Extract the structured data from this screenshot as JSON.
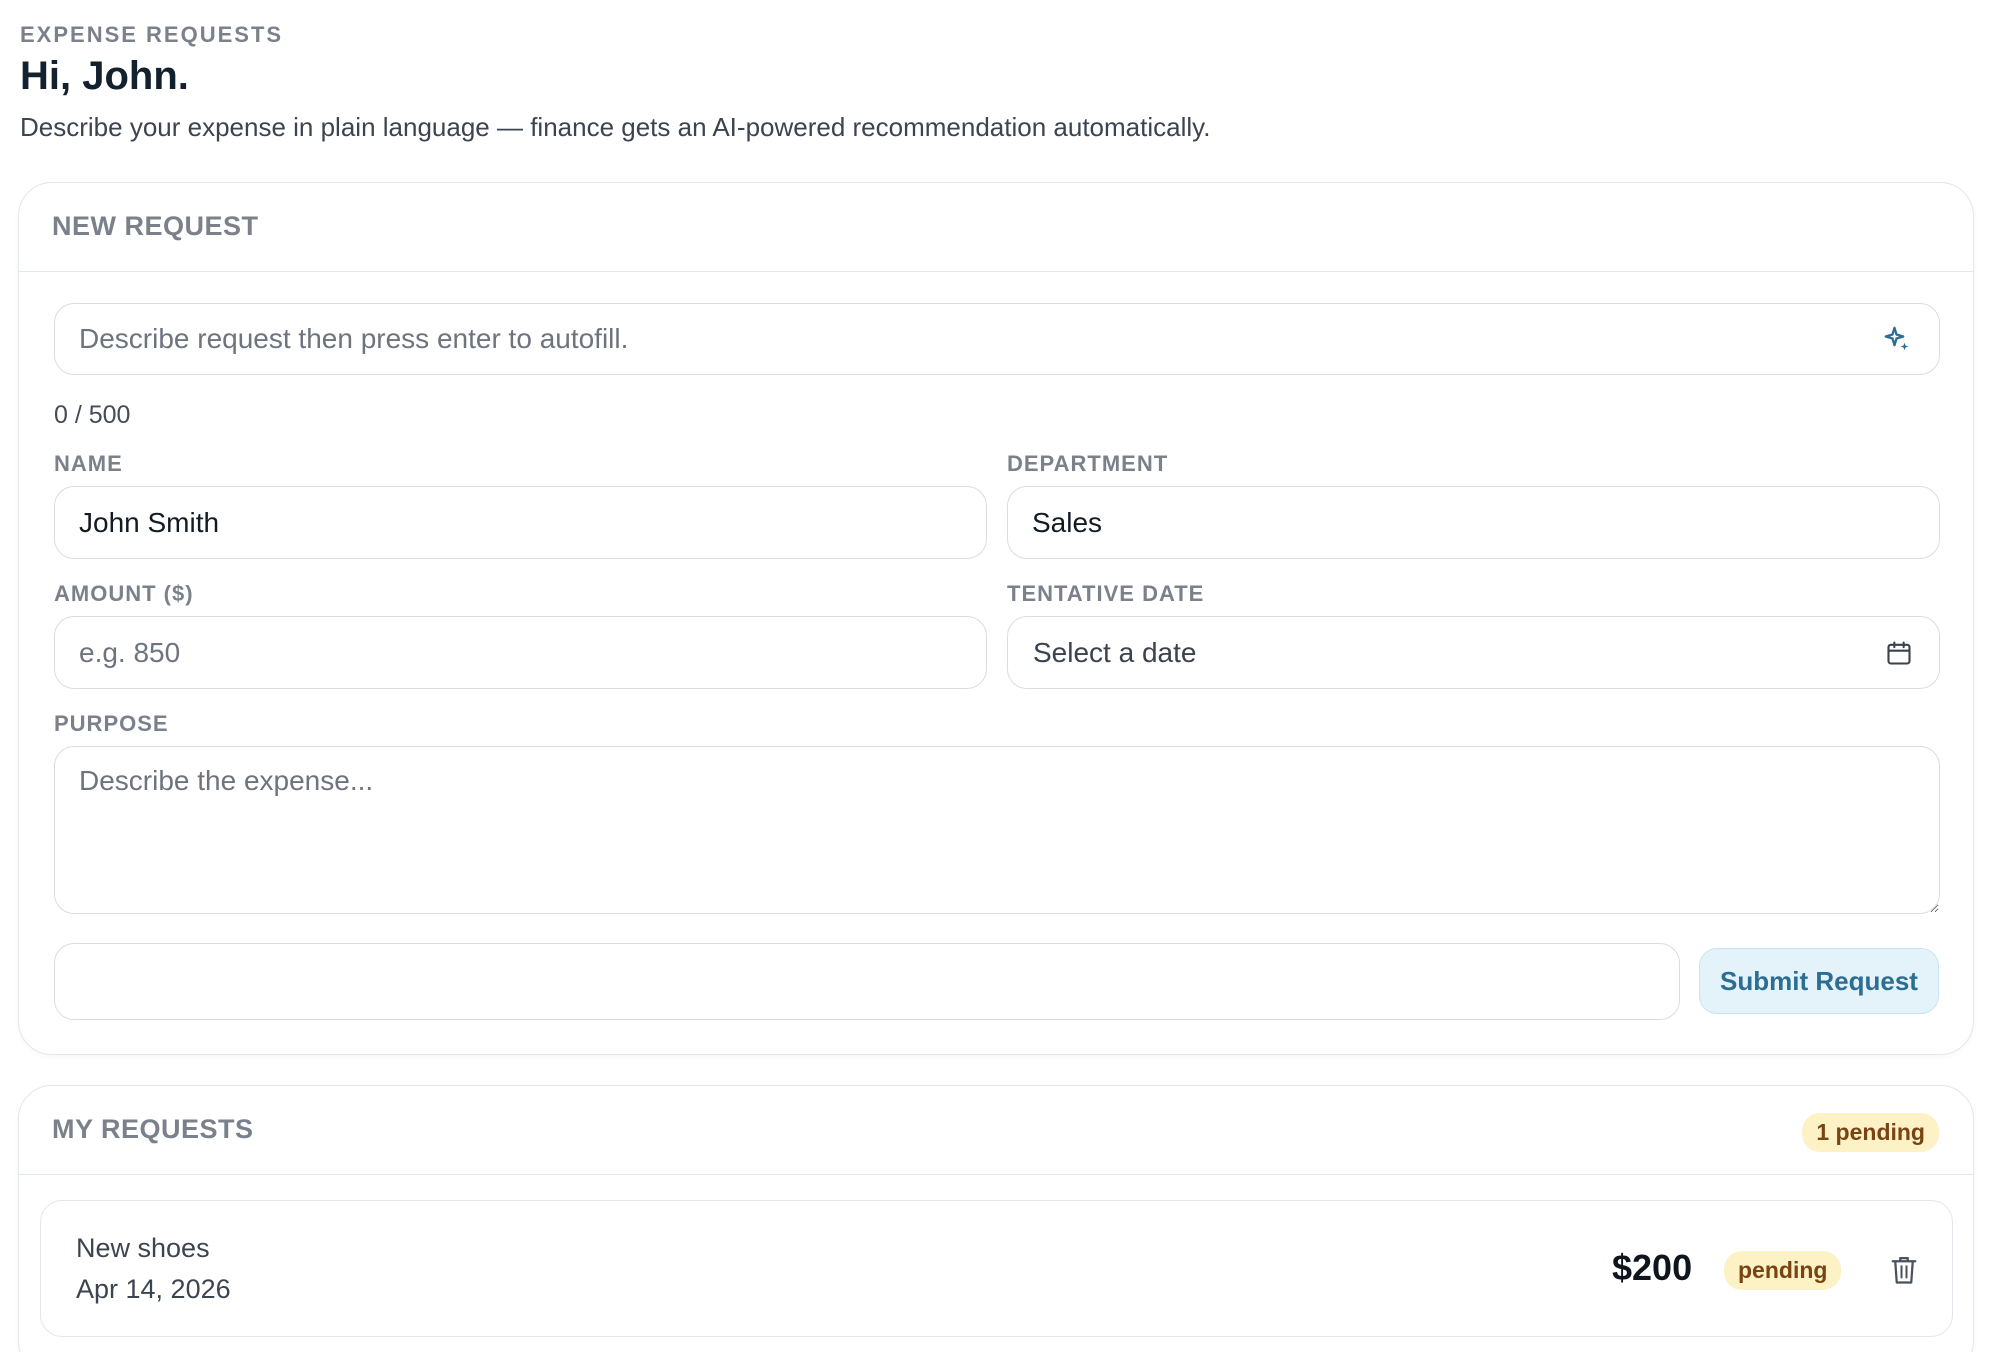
{
  "header": {
    "eyebrow": "EXPENSE REQUESTS",
    "greeting": "Hi, John.",
    "intro": "Describe your expense in plain language — finance gets an AI-powered recommendation automatically."
  },
  "new_request": {
    "title": "NEW REQUEST",
    "autofill_placeholder": "Describe request then press enter to autofill.",
    "autofill_icon": "sparkle-icon",
    "char_counter": "0 / 500",
    "name_label": "NAME",
    "name_value": "John Smith",
    "department_label": "DEPARTMENT",
    "department_value": "Sales",
    "amount_label": "AMOUNT ($)",
    "amount_placeholder": "e.g. 850",
    "date_label": "TENTATIVE DATE",
    "date_placeholder": "Select a date",
    "date_icon": "calendar-icon",
    "purpose_label": "PURPOSE",
    "purpose_placeholder": "Describe the expense...",
    "extra_value": "",
    "submit_label": "Submit Request"
  },
  "my_requests": {
    "title": "MY REQUESTS",
    "pending_badge": "1 pending",
    "items": [
      {
        "title": "New shoes",
        "date": "Apr 14, 2026",
        "amount": "$200",
        "status": "pending",
        "delete_icon": "trash-icon"
      }
    ]
  },
  "colors": {
    "accent": "#2c6d94",
    "accent_bg": "#e4f3fa",
    "pending_bg": "#fdf1c6",
    "pending_text": "#7a4312",
    "border": "#e3e6ea",
    "muted_label": "#7b818b"
  }
}
